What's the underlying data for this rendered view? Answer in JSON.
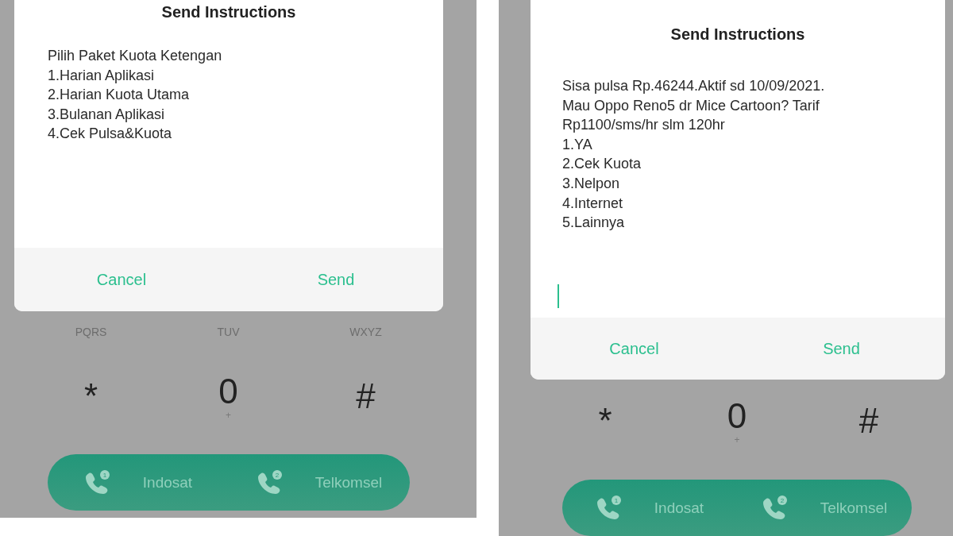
{
  "screens": [
    {
      "dialog": {
        "title": "Send Instructions",
        "message_lines": [
          "Pilih Paket Kuota Ketengan",
          "1.Harian Aplikasi",
          "2.Harian Kuota Utama",
          "3.Bulanan Aplikasi",
          "4.Cek Pulsa&Kuota"
        ],
        "buttons": [
          "Cancel",
          "Send"
        ]
      },
      "keypad": {
        "letter_row": [
          "PQRS",
          "TUV",
          "WXYZ"
        ],
        "symbol_row": [
          {
            "key": "*"
          },
          {
            "key": "0",
            "sub": "+"
          },
          {
            "key": "#"
          }
        ]
      },
      "sim_buttons": [
        {
          "sim": "1",
          "label": "Indosat"
        },
        {
          "sim": "2",
          "label": "Telkomsel"
        }
      ]
    },
    {
      "dialog": {
        "title": "Send Instructions",
        "message_lines": [
          "Sisa pulsa Rp.46244.Aktif sd 10/09/2021.",
          "Mau Oppo Reno5 dr Mice Cartoon? Tarif",
          "Rp1100/sms/hr slm 120hr",
          "1.YA",
          "2.Cek Kuota",
          "3.Nelpon",
          "4.Internet",
          "5.Lainnya"
        ],
        "input_focused": true,
        "buttons": [
          "Cancel",
          "Send"
        ]
      },
      "keypad": {
        "symbol_row": [
          {
            "key": "*"
          },
          {
            "key": "0",
            "sub": "+"
          },
          {
            "key": "#"
          }
        ]
      },
      "sim_buttons": [
        {
          "sim": "1",
          "label": "Indosat"
        },
        {
          "sim": "2",
          "label": "Telkomsel"
        }
      ]
    }
  ]
}
